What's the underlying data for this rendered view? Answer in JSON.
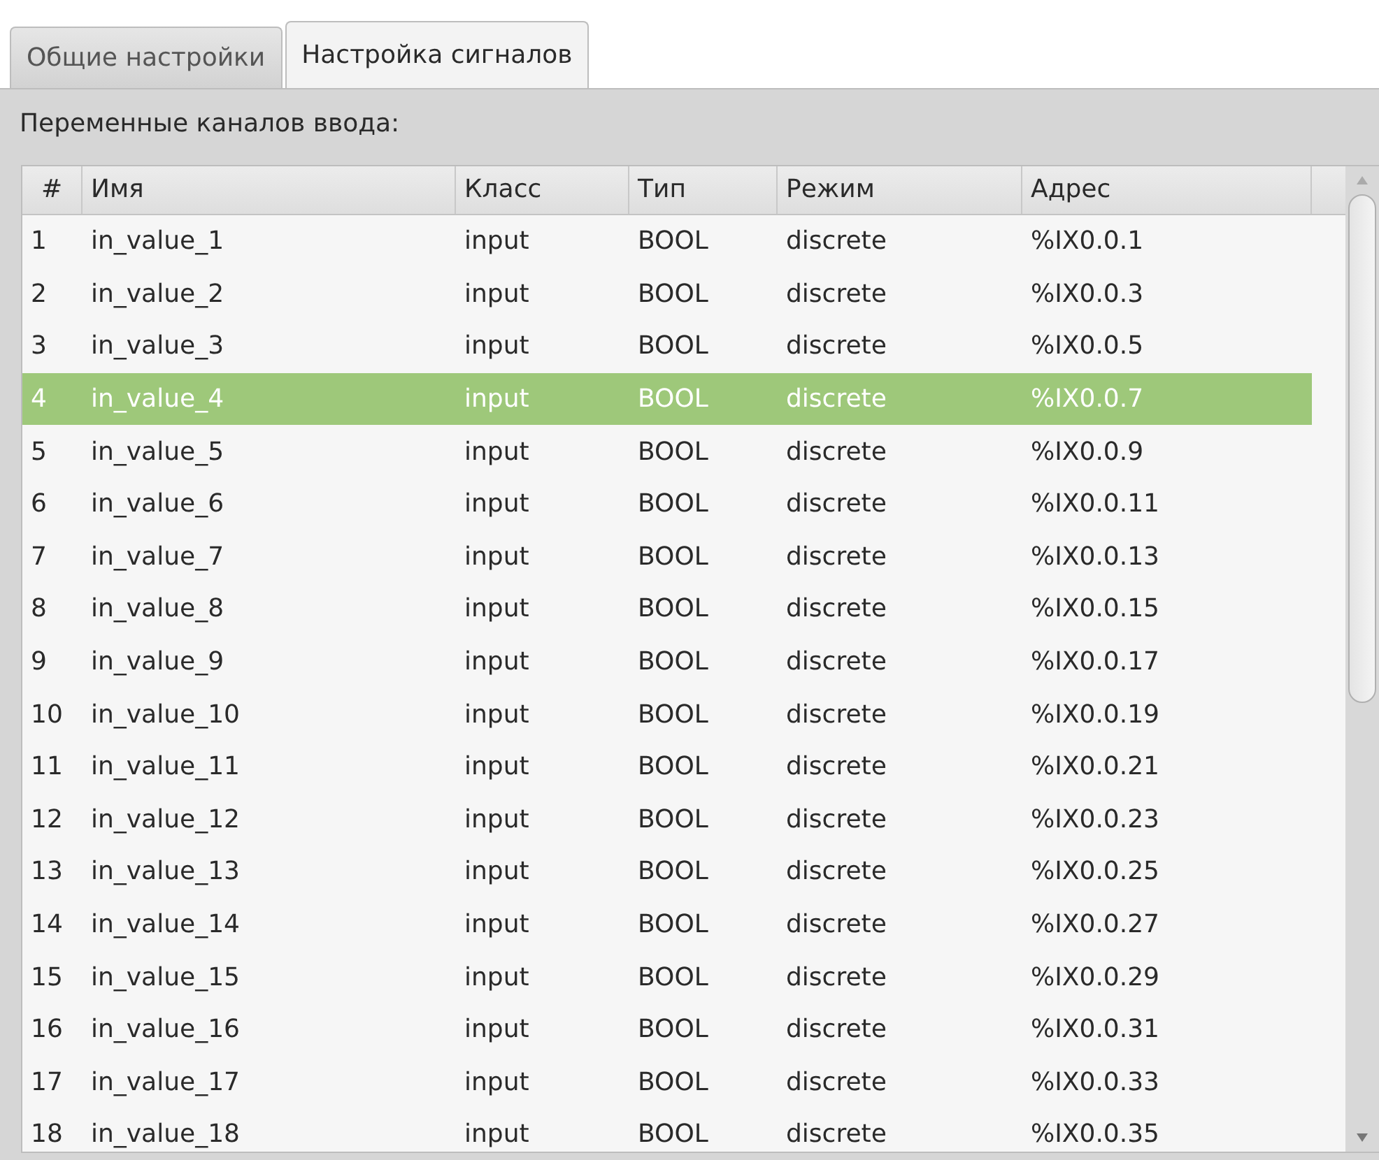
{
  "tabs": [
    {
      "label": "Общие настройки",
      "selected": false
    },
    {
      "label": "Настройка сигналов",
      "selected": true
    }
  ],
  "section_label": "Переменные каналов ввода:",
  "table": {
    "columns": [
      "#",
      "Имя",
      "Класс",
      "Тип",
      "Режим",
      "Адрес"
    ],
    "rows": [
      {
        "cells": [
          "1",
          "in_value_1",
          "input",
          "BOOL",
          "discrete",
          "%IX0.0.1"
        ],
        "selected": false
      },
      {
        "cells": [
          "2",
          "in_value_2",
          "input",
          "BOOL",
          "discrete",
          "%IX0.0.3"
        ],
        "selected": false
      },
      {
        "cells": [
          "3",
          "in_value_3",
          "input",
          "BOOL",
          "discrete",
          "%IX0.0.5"
        ],
        "selected": false
      },
      {
        "cells": [
          "4",
          "in_value_4",
          "input",
          "BOOL",
          "discrete",
          "%IX0.0.7"
        ],
        "selected": true
      },
      {
        "cells": [
          "5",
          "in_value_5",
          "input",
          "BOOL",
          "discrete",
          "%IX0.0.9"
        ],
        "selected": false
      },
      {
        "cells": [
          "6",
          "in_value_6",
          "input",
          "BOOL",
          "discrete",
          "%IX0.0.11"
        ],
        "selected": false
      },
      {
        "cells": [
          "7",
          "in_value_7",
          "input",
          "BOOL",
          "discrete",
          "%IX0.0.13"
        ],
        "selected": false
      },
      {
        "cells": [
          "8",
          "in_value_8",
          "input",
          "BOOL",
          "discrete",
          "%IX0.0.15"
        ],
        "selected": false
      },
      {
        "cells": [
          "9",
          "in_value_9",
          "input",
          "BOOL",
          "discrete",
          "%IX0.0.17"
        ],
        "selected": false
      },
      {
        "cells": [
          "10",
          "in_value_10",
          "input",
          "BOOL",
          "discrete",
          "%IX0.0.19"
        ],
        "selected": false
      },
      {
        "cells": [
          "11",
          "in_value_11",
          "input",
          "BOOL",
          "discrete",
          "%IX0.0.21"
        ],
        "selected": false
      },
      {
        "cells": [
          "12",
          "in_value_12",
          "input",
          "BOOL",
          "discrete",
          "%IX0.0.23"
        ],
        "selected": false
      },
      {
        "cells": [
          "13",
          "in_value_13",
          "input",
          "BOOL",
          "discrete",
          "%IX0.0.25"
        ],
        "selected": false
      },
      {
        "cells": [
          "14",
          "in_value_14",
          "input",
          "BOOL",
          "discrete",
          "%IX0.0.27"
        ],
        "selected": false
      },
      {
        "cells": [
          "15",
          "in_value_15",
          "input",
          "BOOL",
          "discrete",
          "%IX0.0.29"
        ],
        "selected": false
      },
      {
        "cells": [
          "16",
          "in_value_16",
          "input",
          "BOOL",
          "discrete",
          "%IX0.0.31"
        ],
        "selected": false
      },
      {
        "cells": [
          "17",
          "in_value_17",
          "input",
          "BOOL",
          "discrete",
          "%IX0.0.33"
        ],
        "selected": false
      },
      {
        "cells": [
          "18",
          "in_value_18",
          "input",
          "BOOL",
          "discrete",
          "%IX0.0.35"
        ],
        "selected": false
      }
    ]
  }
}
